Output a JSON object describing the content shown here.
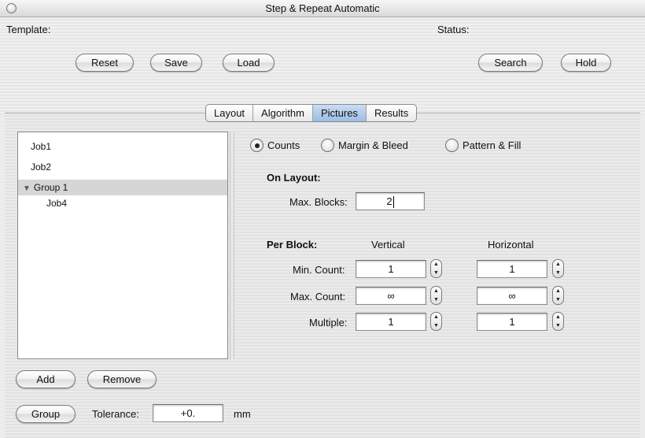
{
  "window": {
    "title": "Step & Repeat Automatic"
  },
  "header": {
    "template_label": "Template:",
    "status_label": "Status:",
    "buttons": {
      "reset": "Reset",
      "save": "Save",
      "load": "Load",
      "search": "Search",
      "hold": "Hold"
    }
  },
  "tabs": [
    {
      "label": "Layout",
      "active": false
    },
    {
      "label": "Algorithm",
      "active": false
    },
    {
      "label": "Pictures",
      "active": true
    },
    {
      "label": "Results",
      "active": false
    }
  ],
  "tree": {
    "items": [
      {
        "label": "Job1",
        "level": 0,
        "selected": false
      },
      {
        "label": "Job2",
        "level": 0,
        "selected": false
      },
      {
        "label": "Group 1",
        "level": 0,
        "expanded": true,
        "selected": true
      },
      {
        "label": "Job4",
        "level": 1,
        "selected": false
      }
    ]
  },
  "left_buttons": {
    "add": "Add",
    "remove": "Remove",
    "group": "Group"
  },
  "tolerance": {
    "label": "Tolerance:",
    "value": "+0.",
    "unit": "mm"
  },
  "mode_radios": {
    "selected": "Counts",
    "options": [
      "Counts",
      "Margin & Bleed",
      "Pattern & Fill"
    ]
  },
  "on_layout": {
    "heading": "On Layout:",
    "max_blocks_label": "Max. Blocks:",
    "max_blocks_value": "2"
  },
  "per_block": {
    "heading": "Per Block:",
    "vertical_header": "Vertical",
    "horizontal_header": "Horizontal",
    "rows": [
      {
        "label": "Min. Count:",
        "vertical": "1",
        "horizontal": "1"
      },
      {
        "label": "Max. Count:",
        "vertical": "∞",
        "horizontal": "∞"
      },
      {
        "label": "Multiple:",
        "vertical": "1",
        "horizontal": "1"
      }
    ]
  }
}
